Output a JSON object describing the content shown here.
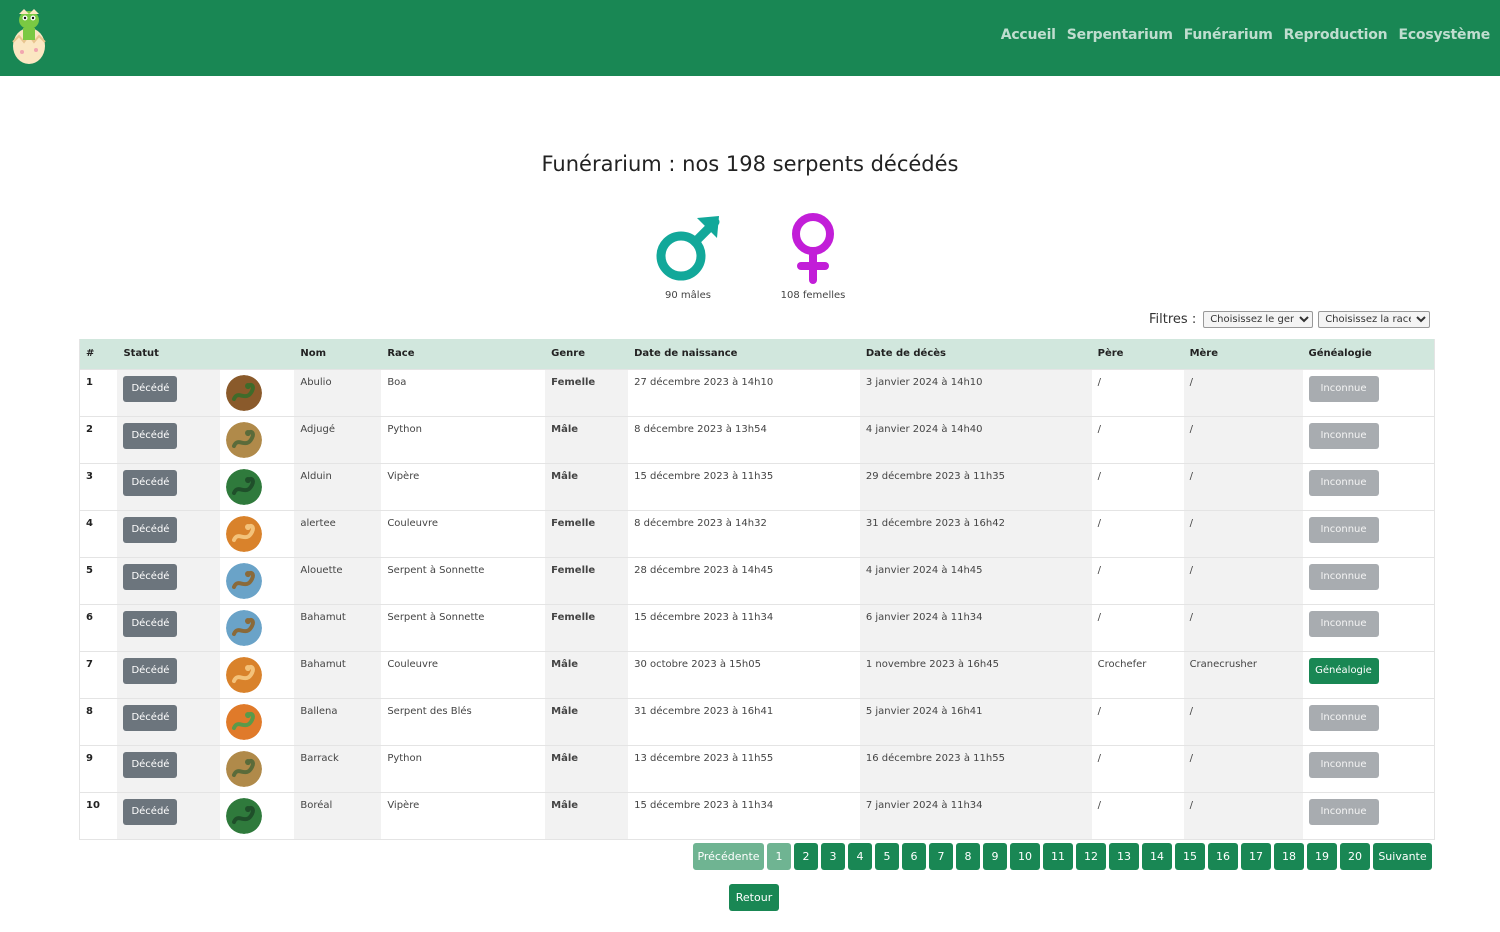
{
  "nav": {
    "links": [
      "Accueil",
      "Serpentarium",
      "Funérarium",
      "Reproduction",
      "Ecosystème"
    ]
  },
  "page": {
    "title": "Funérarium : nos 198 serpents décédés"
  },
  "stats": {
    "male_caption": "90 mâles",
    "female_caption": "108 femelles",
    "male_color": "#12a89a",
    "female_color": "#c21ed8"
  },
  "filters": {
    "label": "Filtres :",
    "genre_selected": "Choisissez le genre",
    "race_selected": "Choisissez la race"
  },
  "table": {
    "headers": [
      "#",
      "Statut",
      "",
      "Nom",
      "Race",
      "Genre",
      "Date de naissance",
      "Date de décès",
      "Père",
      "Mère",
      "Généalogie"
    ],
    "rows": [
      {
        "num": "1",
        "status": "Décédé",
        "avatar": "snake-brown",
        "name": "Abulio",
        "race": "Boa",
        "genre": "Femelle",
        "birth": "27 décembre 2023 à 14h10",
        "death": "3 janvier 2024 à 14h10",
        "father": "/",
        "mother": "/",
        "genealogy": "Inconnue"
      },
      {
        "num": "2",
        "status": "Décédé",
        "avatar": "snake-tan",
        "name": "Adjugé",
        "race": "Python",
        "genre": "Mâle",
        "birth": "8 décembre 2023 à 13h54",
        "death": "4 janvier 2024 à 14h40",
        "father": "/",
        "mother": "/",
        "genealogy": "Inconnue"
      },
      {
        "num": "3",
        "status": "Décédé",
        "avatar": "snake-green",
        "name": "Alduin",
        "race": "Vipère",
        "genre": "Mâle",
        "birth": "15 décembre 2023 à 11h35",
        "death": "29 décembre 2023 à 11h35",
        "father": "/",
        "mother": "/",
        "genealogy": "Inconnue"
      },
      {
        "num": "4",
        "status": "Décédé",
        "avatar": "snake-orange",
        "name": "alertee",
        "race": "Couleuvre",
        "genre": "Femelle",
        "birth": "8 décembre 2023 à 14h32",
        "death": "31 décembre 2023 à 16h42",
        "father": "/",
        "mother": "/",
        "genealogy": "Inconnue"
      },
      {
        "num": "5",
        "status": "Décédé",
        "avatar": "snake-sky",
        "name": "Alouette",
        "race": "Serpent à Sonnette",
        "genre": "Femelle",
        "birth": "28 décembre 2023 à 14h45",
        "death": "4 janvier 2024 à 14h45",
        "father": "/",
        "mother": "/",
        "genealogy": "Inconnue"
      },
      {
        "num": "6",
        "status": "Décédé",
        "avatar": "snake-sky",
        "name": "Bahamut",
        "race": "Serpent à Sonnette",
        "genre": "Femelle",
        "birth": "15 décembre 2023 à 11h34",
        "death": "6 janvier 2024 à 11h34",
        "father": "/",
        "mother": "/",
        "genealogy": "Inconnue"
      },
      {
        "num": "7",
        "status": "Décédé",
        "avatar": "snake-orange",
        "name": "Bahamut",
        "race": "Couleuvre",
        "genre": "Mâle",
        "birth": "30 octobre 2023 à 15h05",
        "death": "1 novembre 2023 à 16h45",
        "father": "Crochefer",
        "mother": "Cranecrusher",
        "genealogy": "Généalogie"
      },
      {
        "num": "8",
        "status": "Décédé",
        "avatar": "snake-corn",
        "name": "Ballena",
        "race": "Serpent des Blés",
        "genre": "Mâle",
        "birth": "31 décembre 2023 à 16h41",
        "death": "5 janvier 2024 à 16h41",
        "father": "/",
        "mother": "/",
        "genealogy": "Inconnue"
      },
      {
        "num": "9",
        "status": "Décédé",
        "avatar": "snake-tan",
        "name": "Barrack",
        "race": "Python",
        "genre": "Mâle",
        "birth": "13 décembre 2023 à 11h55",
        "death": "16 décembre 2023 à 11h55",
        "father": "/",
        "mother": "/",
        "genealogy": "Inconnue"
      },
      {
        "num": "10",
        "status": "Décédé",
        "avatar": "snake-green",
        "name": "Boréal",
        "race": "Vipère",
        "genre": "Mâle",
        "birth": "15 décembre 2023 à 11h34",
        "death": "7 janvier 2024 à 11h34",
        "father": "/",
        "mother": "/",
        "genealogy": "Inconnue"
      }
    ]
  },
  "pagination": {
    "prev": "Précédente",
    "pages": [
      "1",
      "2",
      "3",
      "4",
      "5",
      "6",
      "7",
      "8",
      "9",
      "10",
      "11",
      "12",
      "13",
      "14",
      "15",
      "16",
      "17",
      "18",
      "19",
      "20"
    ],
    "active_page": "1",
    "next": "Suivante"
  },
  "back_label": "Retour"
}
